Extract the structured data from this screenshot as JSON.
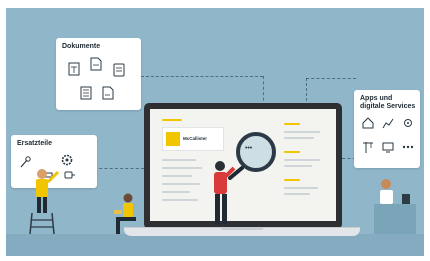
{
  "colors": {
    "background": "#8fb6c9",
    "accent": "#f1c500",
    "dark": "#1e2a33"
  },
  "cards": {
    "documents": {
      "title": "Dokumente",
      "icons": [
        "document-icon",
        "document-icon",
        "document-icon",
        "document-icon",
        "document-icon"
      ]
    },
    "profession": {
      "title": "Ersatzteile",
      "icons": [
        "wrench-icon",
        "gear-icon",
        "tool-icon",
        "plug-icon"
      ]
    },
    "apps": {
      "title": "Apps und digitale Services",
      "icons": [
        "home-icon",
        "chart-icon",
        "settings-icon",
        "crane-icon",
        "device-icon",
        "more-icon"
      ]
    }
  },
  "laptop": {
    "profile": {
      "name": "McCallister"
    },
    "search": {
      "icon": "magnifier-icon",
      "dots": "• • •"
    }
  }
}
